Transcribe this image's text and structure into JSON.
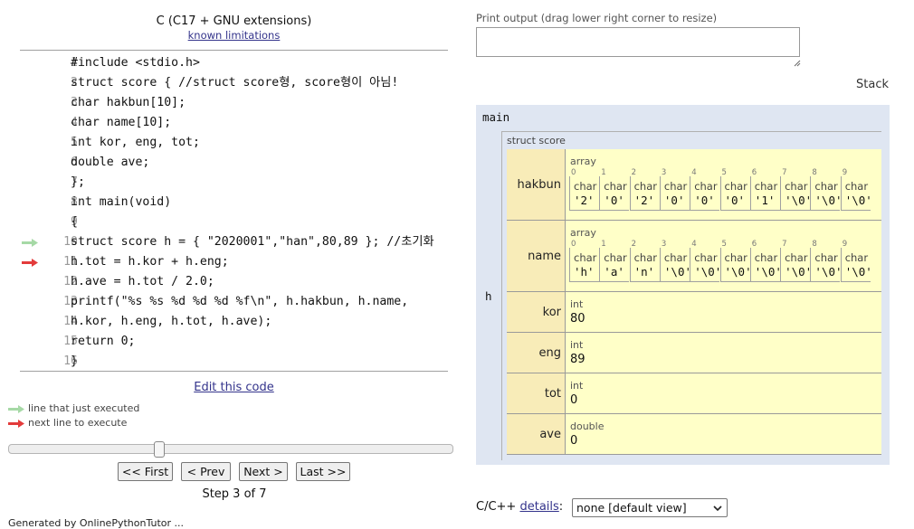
{
  "header": {
    "language": "C (C17 + GNU extensions)",
    "limitations_link": "known limitations"
  },
  "code": {
    "lines": [
      {
        "num": "1",
        "text": "#include <stdio.h>"
      },
      {
        "num": "2",
        "text": "struct score { //struct score형, score형이 아님!"
      },
      {
        "num": "3",
        "text": "char hakbun[10];"
      },
      {
        "num": "4",
        "text": "char name[10];"
      },
      {
        "num": "5",
        "text": "int kor, eng, tot;"
      },
      {
        "num": "6",
        "text": "double ave;"
      },
      {
        "num": "7",
        "text": "};"
      },
      {
        "num": "8",
        "text": "int main(void)"
      },
      {
        "num": "9",
        "text": "{"
      },
      {
        "num": "10",
        "text": "struct score h = { \"2020001\",\"han\",80,89 }; //초기화"
      },
      {
        "num": "11",
        "text": "h.tot = h.kor + h.eng;"
      },
      {
        "num": "12",
        "text": "h.ave = h.tot / 2.0;"
      },
      {
        "num": "13",
        "text": "printf(\"%s %s %d %d %d %f\\n\", h.hakbun, h.name,"
      },
      {
        "num": "14",
        "text": "h.kor, h.eng, h.tot, h.ave);"
      },
      {
        "num": "15",
        "text": "return 0;"
      },
      {
        "num": "16",
        "text": "}"
      }
    ],
    "executed_line": "10",
    "next_line": "11"
  },
  "edit_link": "Edit this code",
  "legend": {
    "executed": "line that just executed",
    "next": "next line to execute"
  },
  "nav": {
    "first": "<< First",
    "prev": "< Prev",
    "next": "Next >",
    "last": "Last >>",
    "step_text": "Step 3 of 7",
    "step_current": 3,
    "step_total": 7
  },
  "cutoff_text": "Generated by OnlinePythonTutor ...",
  "print_output_label": "Print output (drag lower right corner to resize)",
  "print_output_value": "",
  "stack": {
    "label": "Stack",
    "frame_name": "main",
    "var_name": "h",
    "struct_type": "struct score",
    "fields": {
      "hakbun": {
        "name": "hakbun",
        "type": "array",
        "elem_type": "char",
        "indices": [
          "0",
          "1",
          "2",
          "3",
          "4",
          "5",
          "6",
          "7",
          "8",
          "9"
        ],
        "values": [
          "'2'",
          "'0'",
          "'2'",
          "'0'",
          "'0'",
          "'0'",
          "'1'",
          "'\\0'",
          "'\\0'",
          "'\\0'"
        ]
      },
      "name": {
        "name": "name",
        "type": "array",
        "elem_type": "char",
        "indices": [
          "0",
          "1",
          "2",
          "3",
          "4",
          "5",
          "6",
          "7",
          "8",
          "9"
        ],
        "values": [
          "'h'",
          "'a'",
          "'n'",
          "'\\0'",
          "'\\0'",
          "'\\0'",
          "'\\0'",
          "'\\0'",
          "'\\0'",
          "'\\0'"
        ]
      },
      "kor": {
        "name": "kor",
        "type": "int",
        "value": "80"
      },
      "eng": {
        "name": "eng",
        "type": "int",
        "value": "89"
      },
      "tot": {
        "name": "tot",
        "type": "int",
        "value": "0"
      },
      "ave": {
        "name": "ave",
        "type": "double",
        "value": "0"
      }
    }
  },
  "view_option": {
    "label": "C/C++",
    "details_link": "details",
    "selected": "none [default view]"
  },
  "colors": {
    "executed_arrow": "#a6d9a6",
    "next_arrow": "#e33b3b",
    "frame_bg": "#dfe6f2",
    "value_bg": "#ffffc8",
    "name_bg": "#f8ecb8",
    "link": "#33338b"
  }
}
